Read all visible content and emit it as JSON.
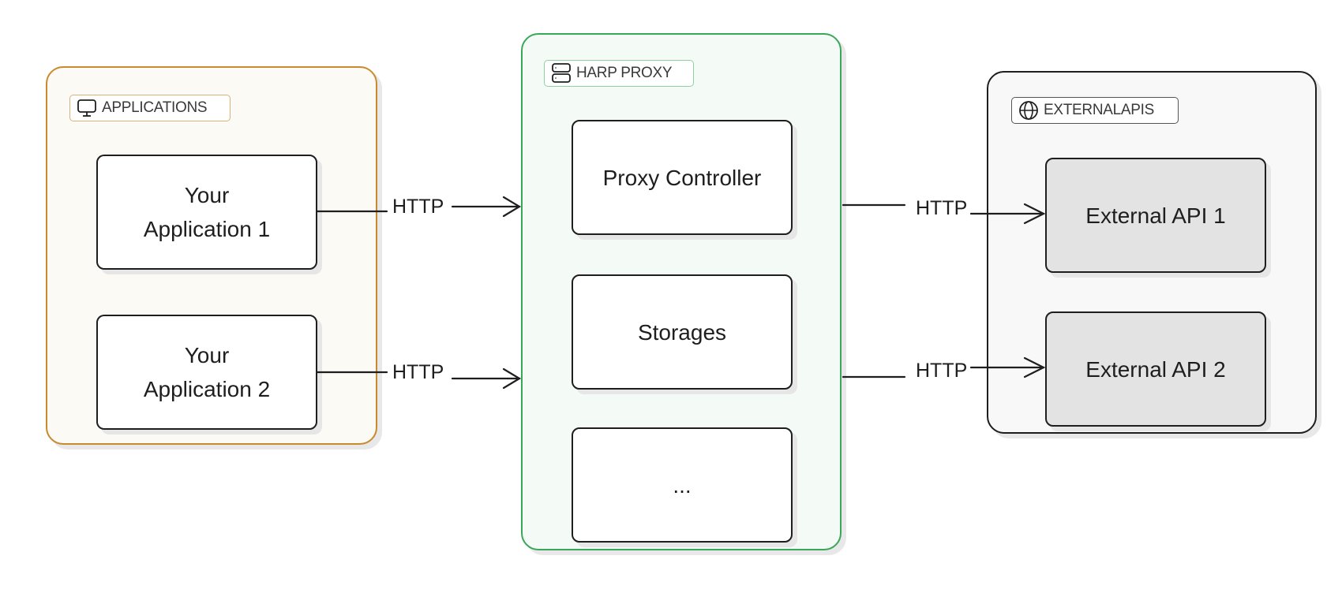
{
  "groups": {
    "applications": {
      "label": "APPLICATIONS",
      "icon": "monitor-icon",
      "border_color": "#c98a2e",
      "fill_color": "#fbfaf5"
    },
    "harp_proxy": {
      "label": "HARP PROXY",
      "icon": "server-icon",
      "border_color": "#3aa659",
      "fill_color": "#f4fbf6"
    },
    "external_apis": {
      "label": "EXTERNALAPIS",
      "icon": "globe-icon",
      "border_color": "#1e1e1e",
      "fill_color": "#f8f8f8"
    }
  },
  "nodes": {
    "app1": {
      "line1": "Your",
      "line2": "Application 1"
    },
    "app2": {
      "line1": "Your",
      "line2": "Application 2"
    },
    "proxy_controller": "Proxy Controller",
    "storages": "Storages",
    "more": "...",
    "external_api_1": "External API 1",
    "external_api_2": "External API 2"
  },
  "edges": [
    {
      "from": "Your Application 1",
      "to": "HARP PROXY",
      "label": "HTTP"
    },
    {
      "from": "Your Application 2",
      "to": "HARP PROXY",
      "label": "HTTP"
    },
    {
      "from": "HARP PROXY",
      "to": "External API 1",
      "label": "HTTP"
    },
    {
      "from": "HARP PROXY",
      "to": "External API 2",
      "label": "HTTP"
    }
  ]
}
